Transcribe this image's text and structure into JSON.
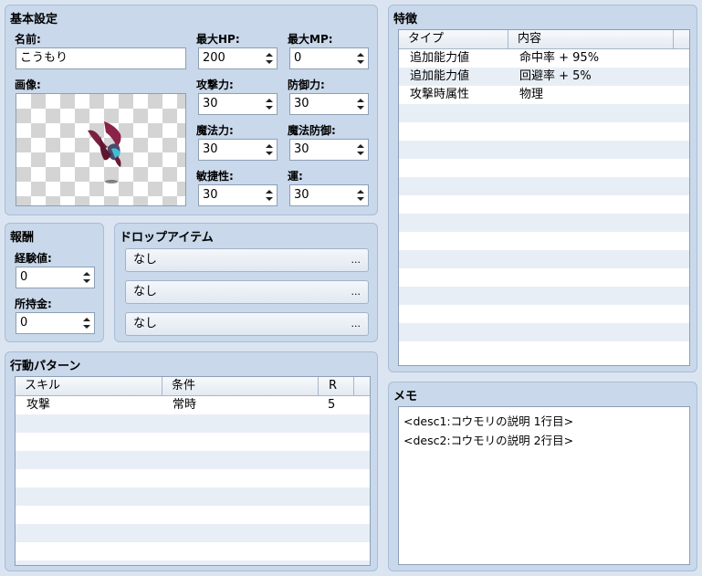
{
  "basic": {
    "title": "基本設定",
    "name_label": "名前:",
    "name_value": "こうもり",
    "image_label": "画像:",
    "maxhp_label": "最大HP:",
    "maxhp": "200",
    "maxmp_label": "最大MP:",
    "maxmp": "0",
    "atk_label": "攻撃力:",
    "atk": "30",
    "def_label": "防御力:",
    "def": "30",
    "mat_label": "魔法力:",
    "mat": "30",
    "mdf_label": "魔法防御:",
    "mdf": "30",
    "agi_label": "敏捷性:",
    "agi": "30",
    "luk_label": "運:",
    "luk": "30"
  },
  "rewards": {
    "title": "報酬",
    "exp_label": "経験値:",
    "exp": "0",
    "gold_label": "所持金:",
    "gold": "0"
  },
  "drops": {
    "title": "ドロップアイテム",
    "items": [
      "なし",
      "なし",
      "なし"
    ],
    "dots": "..."
  },
  "actions": {
    "title": "行動パターン",
    "columns": [
      "スキル",
      "条件",
      "R"
    ],
    "rows": [
      {
        "skill": "攻撃",
        "condition": "常時",
        "rating": "5"
      }
    ]
  },
  "traits": {
    "title": "特徴",
    "columns": [
      "タイプ",
      "内容"
    ],
    "rows": [
      {
        "type": "追加能力値",
        "content": "命中率 + 95%"
      },
      {
        "type": "追加能力値",
        "content": "回避率 + 5%"
      },
      {
        "type": "攻撃時属性",
        "content": "物理"
      }
    ]
  },
  "memo": {
    "title": "メモ",
    "lines": [
      "<desc1:コウモリの説明 1行目>",
      "<desc2:コウモリの説明 2行目>"
    ]
  }
}
